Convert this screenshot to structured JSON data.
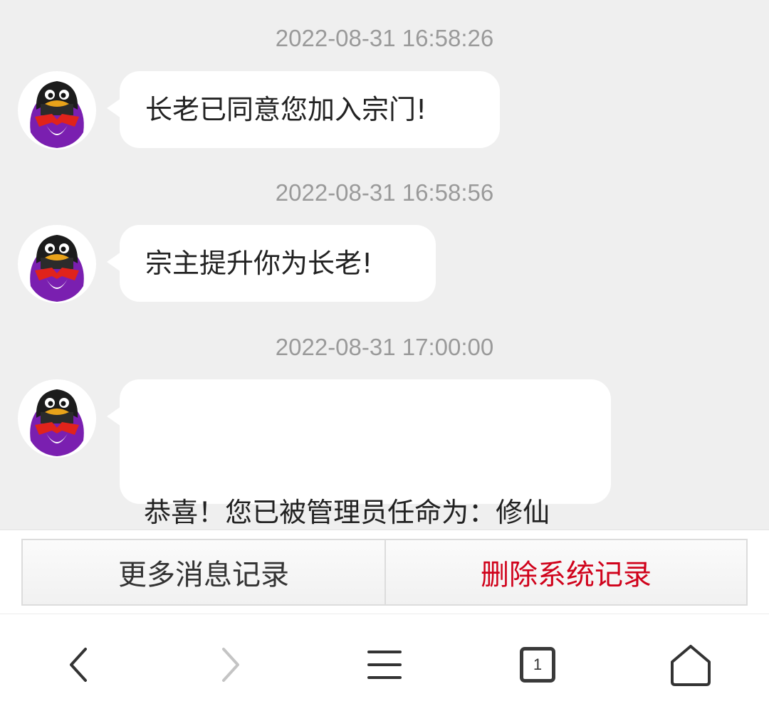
{
  "messages": [
    {
      "timestamp": "2022-08-31 16:58:26",
      "text": "长老已同意您加入宗门!"
    },
    {
      "timestamp": "2022-08-31 16:58:56",
      "text": "宗主提升你为长老!"
    },
    {
      "timestamp": "2022-08-31 17:00:00",
      "text": " 恭喜！您已被管理员任命为：修仙使。"
    }
  ],
  "avatar_icon": "qq-penguin-icon",
  "actions": {
    "more_label": "更多消息记录",
    "delete_label": "删除系统记录",
    "delete_color": "#d0021b"
  },
  "nav": {
    "back_icon": "chevron-left-icon",
    "forward_icon": "chevron-right-icon",
    "menu_icon": "menu-icon",
    "tab_count": "1",
    "home_icon": "home-icon"
  }
}
